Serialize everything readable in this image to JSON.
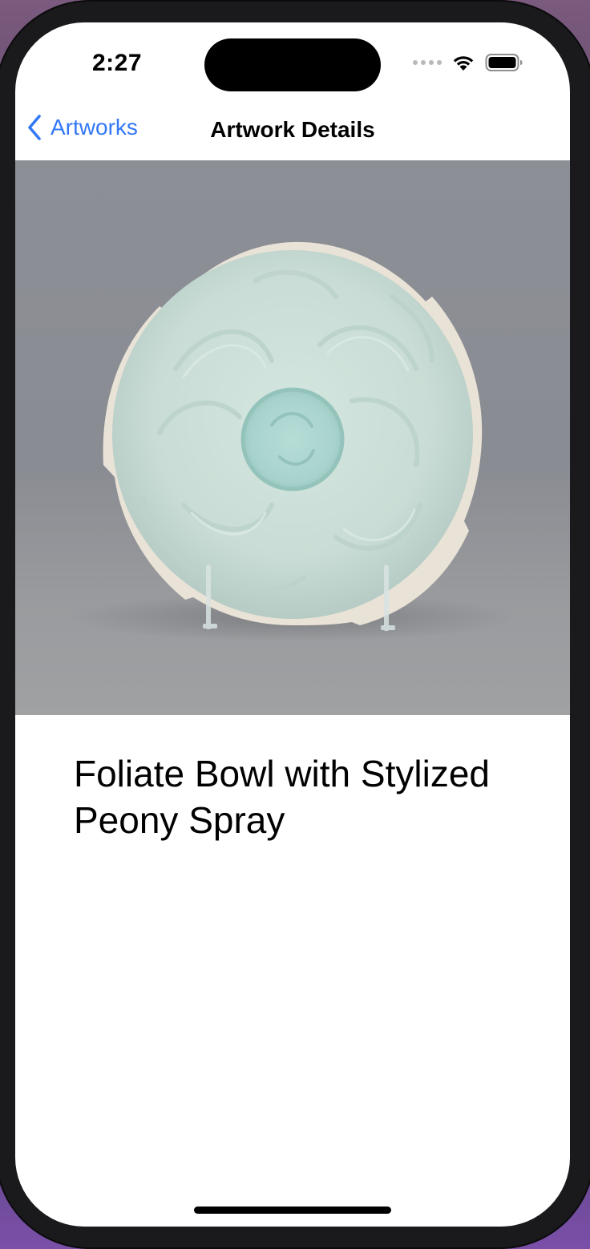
{
  "status_bar": {
    "time": "2:27",
    "icons": [
      "signal-dots-icon",
      "wifi-icon",
      "battery-icon"
    ]
  },
  "nav": {
    "back_label": "Artworks",
    "back_icon": "chevron-left-icon",
    "title": "Artwork Details",
    "accent_color": "#3478f6"
  },
  "artwork": {
    "title": "Foliate Bowl with Stylized Peony Spray"
  }
}
